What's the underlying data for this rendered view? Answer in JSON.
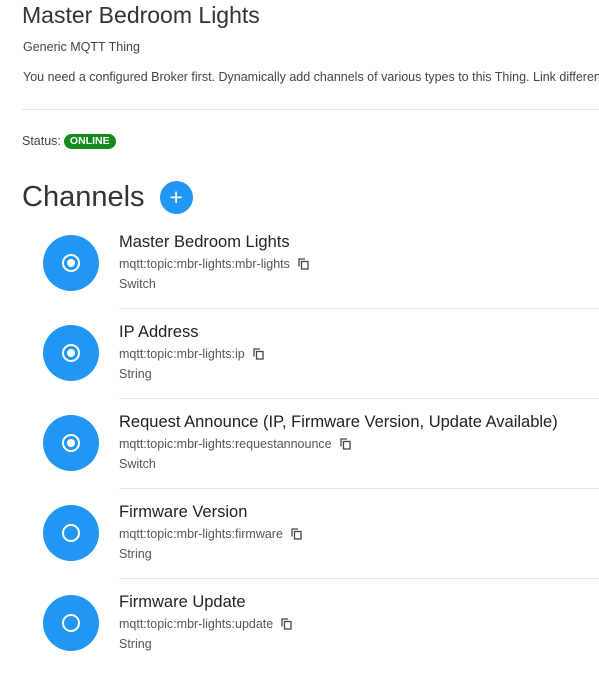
{
  "thing": {
    "title": "Master Bedroom Lights",
    "type": "Generic MQTT Thing",
    "description": "You need a configured Broker first. Dynamically add channels of various types to this Thing. Link different MQTT topics to each channel."
  },
  "status": {
    "label": "Status:",
    "value": "ONLINE",
    "color": "#138a1e"
  },
  "channels": {
    "title": "Channels",
    "add_icon": "plus-icon",
    "accent_color": "#2196f3",
    "items": [
      {
        "name": "Master Bedroom Lights",
        "uid": "mqtt:topic:mbr-lights:mbr-lights",
        "type": "Switch",
        "linked": true
      },
      {
        "name": "IP Address",
        "uid": "mqtt:topic:mbr-lights:ip",
        "type": "String",
        "linked": true
      },
      {
        "name": "Request Announce (IP, Firmware Version, Update Available)",
        "uid": "mqtt:topic:mbr-lights:requestannounce",
        "type": "Switch",
        "linked": true
      },
      {
        "name": "Firmware Version",
        "uid": "mqtt:topic:mbr-lights:firmware",
        "type": "String",
        "linked": false
      },
      {
        "name": "Firmware Update",
        "uid": "mqtt:topic:mbr-lights:update",
        "type": "String",
        "linked": false
      }
    ]
  }
}
